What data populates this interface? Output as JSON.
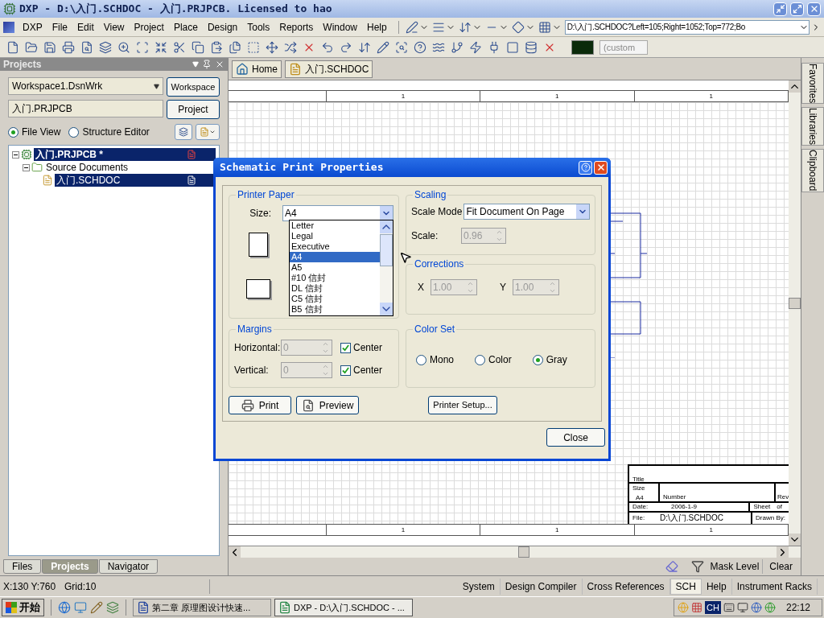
{
  "window": {
    "title": "DXP - D:\\入门.SCHDOC - 入门.PRJPCB. Licensed to hao"
  },
  "menu": [
    "DXP",
    "File",
    "Edit",
    "View",
    "Project",
    "Place",
    "Design",
    "Tools",
    "Reports",
    "Window",
    "Help"
  ],
  "address": "D:\\入门.SCHDOC?Left=105;Right=1052;Top=772;Bo",
  "color_field": "(custom",
  "projects_panel": {
    "title": "Projects",
    "workspace": "Workspace1.DsnWrk",
    "workspace_button": "Workspace",
    "project": "入门.PRJPCB",
    "project_button": "Project",
    "views": [
      {
        "label": "File View",
        "selected": true
      },
      {
        "label": "Structure Editor",
        "selected": false
      }
    ],
    "tree": [
      {
        "label": "入门.PRJPCB *",
        "kind": "project",
        "selected": true,
        "expanded": true,
        "children": [
          {
            "label": "Source Documents",
            "kind": "folder",
            "selected": false,
            "expanded": true,
            "children": [
              {
                "label": "入门.SCHDOC",
                "kind": "document",
                "selected": true
              }
            ]
          }
        ]
      }
    ],
    "tabs": [
      {
        "label": "Files",
        "selected": false
      },
      {
        "label": "Projects",
        "selected": true
      },
      {
        "label": "Navigator",
        "selected": false
      }
    ]
  },
  "doc_tabs": [
    {
      "label": "Home",
      "kind": "home"
    },
    {
      "label": "入门.SCHDOC",
      "kind": "document"
    }
  ],
  "side_tabs": [
    "Favorites",
    "Libraries",
    "Clipboard"
  ],
  "top_ruler": [
    "1",
    "1",
    "1"
  ],
  "bottom_ruler": [
    "1",
    "1",
    "1"
  ],
  "title_block": {
    "title": "Title",
    "size": "Size",
    "size_value": "A4",
    "number": "Number",
    "revision": "Rev",
    "date": "Date:",
    "date_value": "2006-1-9",
    "sheet": "Sheet",
    "of": "of",
    "file": "File:",
    "file_value": "D:\\入门.SCHDOC",
    "drawn_by": "Drawn By:"
  },
  "dialog": {
    "title": "Schematic Print Properties",
    "paper": {
      "title": "Printer Paper",
      "size_label": "Size:",
      "size_value": "A4",
      "options": [
        {
          "label": "Letter",
          "selected": false
        },
        {
          "label": "Legal",
          "selected": false
        },
        {
          "label": "Executive",
          "selected": false
        },
        {
          "label": "A4",
          "selected": true
        },
        {
          "label": "A5",
          "selected": false
        },
        {
          "label": "#10 信封",
          "selected": false
        },
        {
          "label": "DL 信封",
          "selected": false
        },
        {
          "label": "C5 信封",
          "selected": false
        },
        {
          "label": "B5 信封",
          "selected": false
        }
      ]
    },
    "scaling": {
      "title": "Scaling",
      "mode_label": "Scale Mode",
      "mode": "Fit Document On Page",
      "scale_label": "Scale:",
      "scale": {
        "value": "0.96",
        "disabled": true
      }
    },
    "corrections": {
      "title": "Corrections",
      "x_label": "X",
      "x": {
        "value": "1.00",
        "disabled": true
      },
      "y_label": "Y",
      "y": {
        "value": "1.00",
        "disabled": true
      }
    },
    "margins": {
      "title": "Margins",
      "rows": [
        {
          "label": "Horizontal:",
          "field": {
            "value": "0",
            "disabled": true
          },
          "center_label": "Center",
          "checked": true
        },
        {
          "label": "Vertical:",
          "field": {
            "value": "0",
            "disabled": true
          },
          "center_label": "Center",
          "checked": true
        }
      ]
    },
    "color_set": {
      "title": "Color Set",
      "options": [
        {
          "label": "Mono",
          "selected": false
        },
        {
          "label": "Color",
          "selected": false
        },
        {
          "label": "Gray",
          "selected": true
        }
      ]
    },
    "buttons": [
      {
        "label": "Print",
        "kind": "print"
      },
      {
        "label": "Preview",
        "kind": "preview"
      }
    ],
    "setup_button": "Printer Setup...",
    "close_button": "Close"
  },
  "mask_bar": {
    "mask_level": "Mask Level",
    "clear": "Clear"
  },
  "status": {
    "coords": "X:130 Y:760",
    "grid": "Grid:10",
    "buttons": [
      {
        "label": "System",
        "selected": false
      },
      {
        "label": "Design Compiler",
        "selected": false
      },
      {
        "label": "Cross References",
        "selected": false
      },
      {
        "label": "SCH",
        "selected": true
      },
      {
        "label": "Help",
        "selected": false
      },
      {
        "label": "Instrument Racks",
        "selected": false
      }
    ]
  },
  "taskbar": {
    "start": "开始",
    "tasks": [
      {
        "label": "第二章 原理图设计快速...",
        "selected": false
      },
      {
        "label": "DXP - D:\\入门.SCHDOC - ...",
        "selected": true
      }
    ],
    "lang": "CH",
    "clock": "22:12"
  }
}
